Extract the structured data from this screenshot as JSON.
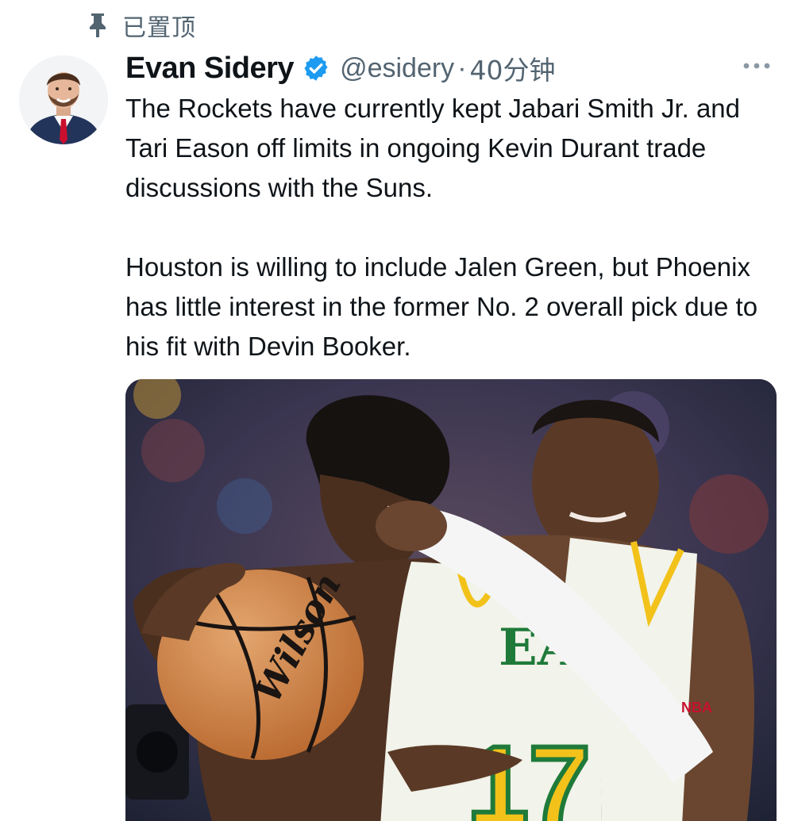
{
  "pinned": {
    "label": "已置顶",
    "icon": "pin-icon"
  },
  "author": {
    "display_name": "Evan Sidery",
    "verified": true,
    "verified_icon": "verified-badge-icon",
    "handle": "@esidery",
    "separator": "·",
    "time": "40分钟"
  },
  "tweet": {
    "paragraphs": [
      "The Rockets have currently kept Jabari Smith Jr. and Tari Eason off limits in ongoing Kevin Durant trade discussions with the Suns.",
      "Houston is willing to include Jalen Green, but Phoenix has little interest in the former No. 2 overall pick due to his fit with Devin Booker."
    ]
  },
  "media": {
    "ball_brand": "Wilson",
    "jersey_name": "EAS",
    "jersey_number": "17",
    "sleeve_logo": "NBA"
  },
  "colors": {
    "accent": "#1d9bf0",
    "text_primary": "#0f1419",
    "text_secondary": "#536471",
    "jersey": "#f2f3ea",
    "jersey_trim": "#f2c21a",
    "jersey_green": "#1f7a3a"
  },
  "icons": {
    "more": "more-dots-icon"
  }
}
